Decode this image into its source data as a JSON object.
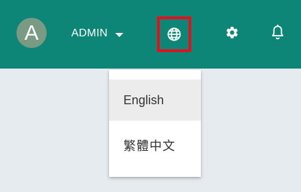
{
  "topbar": {
    "avatar_letter": "A",
    "user_name": "ADMIN",
    "icons": {
      "language": "globe-icon",
      "settings": "gear-icon",
      "notifications": "bell-icon",
      "dropdown": "caret-down-icon"
    },
    "colors": {
      "bar": "#0d8577",
      "avatar": "#7a9a84",
      "highlight_box": "#e5101c"
    }
  },
  "language_menu": {
    "items": [
      {
        "label": "English"
      },
      {
        "label": "繁體中文"
      }
    ]
  },
  "colors": {
    "page_background": "#e6ebef",
    "menu_hover": "#ececec"
  }
}
